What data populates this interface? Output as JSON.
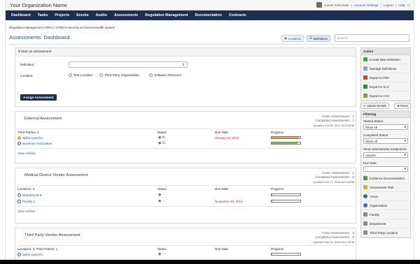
{
  "header": {
    "org": "Your Organization Name",
    "user": "James Schroeder",
    "account": "Account Settings",
    "logout": "Logout",
    "help": "Help"
  },
  "nav": [
    "Dashboard",
    "Tasks",
    "Projects",
    "Events",
    "Audits",
    "Assessments",
    "Regulation Management",
    "Documentation",
    "Contracts"
  ],
  "crumb": "Regulation Management: HIPAA / HITECH Security at General Health System",
  "title": "Assessments: Dashboard",
  "views": {
    "locations": "Locations",
    "definitions": "Definitions"
  },
  "search": {
    "placeholder": "Search"
  },
  "start": {
    "title": "Start an assessment",
    "definition_label": "Definition:",
    "location_label": "Location:",
    "radios": [
      "Test Location",
      "Third Party Organization",
      "Software Resource"
    ],
    "assign": "Assign Assessment"
  },
  "columns": {
    "status": "Status",
    "due": "Due Date",
    "progress": "Progress"
  },
  "stat_labels": {
    "active": "Active Assessments:",
    "completed": "Completed Assessments:"
  },
  "view_archive": "View Archive",
  "assessments": [
    {
      "name": "External Assessment",
      "active": "2",
      "completed": "2",
      "updated": "Updated Oct 25, 2017 at 8:34PM",
      "scope": "Third Parties: 2",
      "rows": [
        {
          "name": "alpha systems",
          "due": "January 31, 2017",
          "progress": 0.95
        },
        {
          "name": "Business Association",
          "due": "",
          "progress": 0.9
        }
      ]
    },
    {
      "name": "Medical Device Vendor Assessment",
      "active": "2",
      "completed": "0",
      "updated": "Updated Oct 17, 2018 at 6:39PM",
      "scope": "Locations: 2",
      "rows": [
        {
          "name": "Department B",
          "due": "",
          "progress": 0.02
        },
        {
          "name": "Facility 2",
          "due": "November 30, 2010",
          "progress": 0.02
        }
      ]
    },
    {
      "name": "Third Party Vendor Assessment",
      "active": "4",
      "completed": "0",
      "updated": "Updated Sep 11, 2018 at 6:32PM",
      "scope": "Locations: 3, Third Parties: 1",
      "rows": [
        {
          "name": "alpha systems",
          "due": "",
          "progress": 0.02
        }
      ]
    }
  ],
  "sidebar": {
    "action_title": "Action",
    "actions": [
      "Create New Definition",
      "Manage Definitions",
      "Export to PDF",
      "Export to XLS",
      "Export to CSV"
    ],
    "update": "Update Results",
    "reset": "Reset",
    "filter_title": "Filtering",
    "filters": [
      {
        "label": "Started Status:",
        "value": "Show All"
      },
      {
        "label": "Completed Status:",
        "value": "Show All"
      },
      {
        "label": "Show assessments assigned to:",
        "value": "Anyone"
      },
      {
        "label": "Due Date:",
        "value": ""
      }
    ],
    "categories": [
      "Evidence Documentation",
      "Assessment Risk",
      "Active",
      "Organization",
      "Facility",
      "Department",
      "Third Party Location"
    ]
  },
  "colors": {
    "nav": "#1d2d55",
    "progress_green": "#7cc04a",
    "progress_orange": "#f0a030",
    "due_red": "#d62020"
  }
}
